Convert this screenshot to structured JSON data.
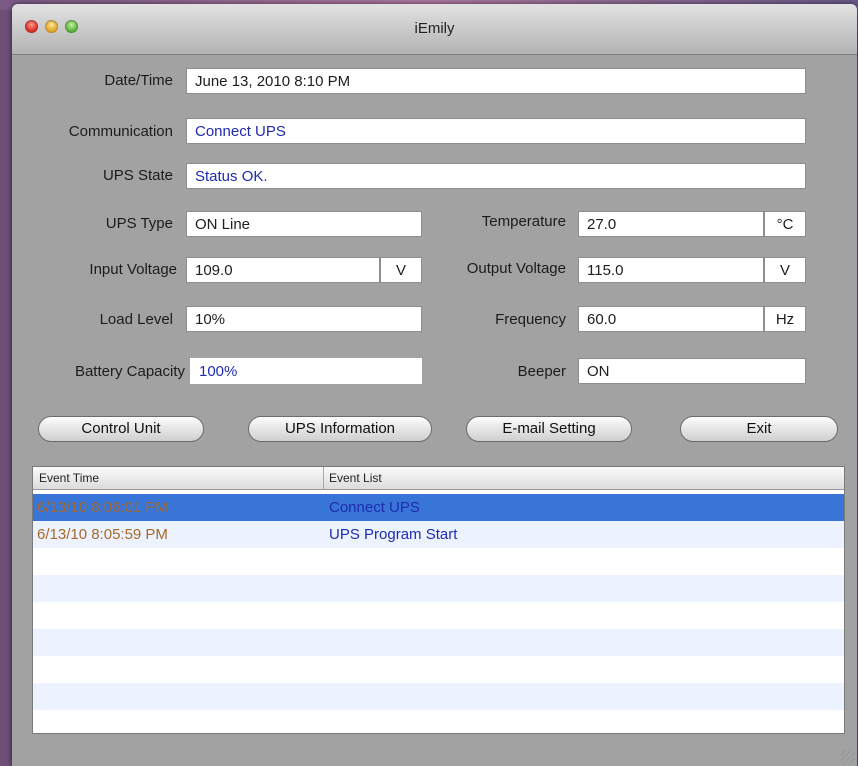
{
  "window": {
    "title": "iEmily"
  },
  "fields": {
    "datetime": {
      "label": "Date/Time",
      "value": "June 13, 2010 8:10 PM"
    },
    "communication": {
      "label": "Communication",
      "value": "Connect UPS"
    },
    "ups_state": {
      "label": "UPS State",
      "value": "Status OK."
    },
    "ups_type": {
      "label": "UPS Type",
      "value": "ON Line"
    },
    "temperature": {
      "label": "Temperature",
      "value": "27.0",
      "unit": "°C"
    },
    "input_voltage": {
      "label": "Input Voltage",
      "value": "109.0",
      "unit": "V"
    },
    "output_voltage": {
      "label": "Output Voltage",
      "value": "115.0",
      "unit": "V"
    },
    "load_level": {
      "label": "Load Level",
      "value": "10%"
    },
    "frequency": {
      "label": "Frequency",
      "value": "60.0",
      "unit": "Hz"
    },
    "battery_capacity": {
      "label": "Battery Capacity",
      "value": "100%"
    },
    "beeper": {
      "label": "Beeper",
      "value": "ON"
    }
  },
  "buttons": {
    "control_unit": "Control Unit",
    "ups_information": "UPS Information",
    "email_setting": "E-mail Setting",
    "exit": "Exit"
  },
  "events": {
    "headers": [
      "Event Time",
      "Event List"
    ],
    "rows": [
      {
        "time": "6/13/10 8:06:01 PM",
        "event": "Connect UPS",
        "selected": true
      },
      {
        "time": "6/13/10 8:05:59 PM",
        "event": "UPS Program Start",
        "selected": false
      }
    ]
  },
  "colors": {
    "selection": "#3875d7",
    "time_text": "#a5692a",
    "event_text": "#1f2bb0",
    "row_alt": "#edf3fe"
  }
}
